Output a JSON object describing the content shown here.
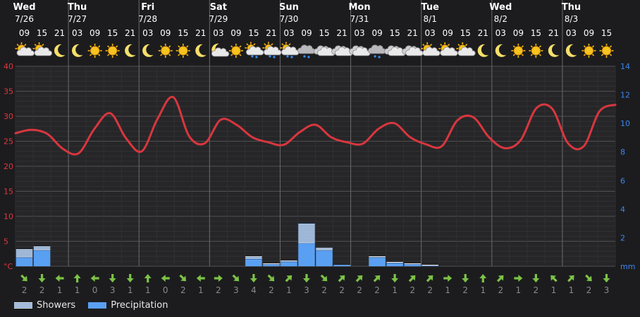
{
  "days": [
    {
      "name": "Wed",
      "date": "7/26"
    },
    {
      "name": "Thu",
      "date": "7/27"
    },
    {
      "name": "Fri",
      "date": "7/28"
    },
    {
      "name": "Sat",
      "date": "7/29"
    },
    {
      "name": "Sun",
      "date": "7/30"
    },
    {
      "name": "Mon",
      "date": "7/31"
    },
    {
      "name": "Tue",
      "date": "8/1"
    },
    {
      "name": "Wed",
      "date": "8/2"
    },
    {
      "name": "Thu",
      "date": "8/3"
    }
  ],
  "hours": [
    "09",
    "15",
    "21",
    "03",
    "09",
    "15",
    "21",
    "03",
    "09",
    "15",
    "21",
    "03",
    "09",
    "15",
    "21",
    "03",
    "09",
    "15",
    "21",
    "03",
    "09",
    "15",
    "21",
    "03",
    "09",
    "15",
    "21",
    "03",
    "09",
    "15",
    "21",
    "03",
    "09",
    "15"
  ],
  "icons": [
    "partly-sunny",
    "partly-sunny",
    "moon",
    "moon",
    "sun",
    "sun",
    "moon",
    "moon",
    "sun",
    "sun",
    "moon",
    "partly-cloudy-night",
    "sun",
    "sun-shower",
    "sun-shower",
    "sun-shower",
    "rain-cloud",
    "cloud",
    "cloud",
    "cloud",
    "rain-cloud",
    "cloud",
    "cloud",
    "partly-sunny",
    "partly-sunny",
    "partly-sunny",
    "moon",
    "moon",
    "sun",
    "sun",
    "moon",
    "moon",
    "sun",
    "sun"
  ],
  "wind": {
    "directions": [
      "SE",
      "S",
      "W",
      "N",
      "W",
      "S",
      "S",
      "N",
      "W",
      "SE",
      "W",
      "E",
      "SE",
      "S",
      "SE",
      "NE",
      "S",
      "SE",
      "NE",
      "NE",
      "NE",
      "S",
      "NE",
      "NE",
      "E",
      "S",
      "N",
      "NE",
      "E",
      "S",
      "NW",
      "NE",
      "SE",
      "S"
    ],
    "speeds": [
      "2",
      "2",
      "1",
      "1",
      "0",
      "3",
      "1",
      "1",
      "0",
      "2",
      "1",
      "2",
      "3",
      "4",
      "2",
      "1",
      "3",
      "2",
      "2",
      "2",
      "2",
      "1",
      "2",
      "2",
      "1",
      "2",
      "1",
      "2",
      "1",
      "2",
      "1",
      "1",
      "2",
      "3"
    ]
  },
  "chart_data": {
    "type": "line",
    "temperature": {
      "unit": "°C",
      "ylim": [
        0,
        40
      ],
      "ticks": [
        "°C",
        "5",
        "10",
        "15",
        "20",
        "25",
        "30",
        "35",
        "40"
      ],
      "values": [
        26.6,
        27.3,
        26.5,
        23.5,
        22.6,
        27.5,
        30.6,
        25.6,
        23.0,
        29.5,
        33.8,
        26.0,
        24.6,
        29.3,
        28.3,
        25.8,
        24.8,
        24.3,
        26.8,
        28.3,
        25.8,
        24.8,
        24.5,
        27.5,
        28.6,
        25.8,
        24.4,
        24.0,
        29.2,
        29.8,
        25.8,
        23.6,
        25.2,
        31.6,
        31.5,
        24.6,
        24.0,
        31.0,
        32.3
      ]
    },
    "precipitation": {
      "unit": "mm",
      "ylim": [
        0,
        14
      ],
      "ticks": [
        "mm",
        "2",
        "4",
        "6",
        "8",
        "10",
        "12",
        "14"
      ],
      "values": [
        0.6,
        1.1,
        0,
        0,
        0,
        0,
        0,
        0,
        0,
        0,
        0,
        0,
        0,
        0.5,
        0.1,
        0.3,
        1.6,
        1.1,
        0.1,
        0,
        0.6,
        0.2,
        0.1,
        0,
        0,
        0,
        0,
        0,
        0,
        0,
        0,
        0,
        0,
        0
      ],
      "showers": [
        0.6,
        0.3,
        0,
        0,
        0,
        0,
        0,
        0,
        0,
        0,
        0,
        0,
        0,
        0.2,
        0.1,
        0.1,
        1.4,
        0.2,
        0,
        0,
        0.1,
        0.1,
        0.1,
        0.1,
        0,
        0,
        0,
        0,
        0,
        0,
        0,
        0,
        0,
        0
      ]
    },
    "grid": true
  },
  "legend": {
    "showers": "Showers",
    "precipitation": "Precipitation"
  },
  "colors": {
    "temp_line": "#d9363e",
    "precip": "#5aa0f2",
    "temp_axis": "#e0373f",
    "precip_axis": "#3b87f0",
    "wind": "#7cc246",
    "grid": "#3d3d40",
    "day_line": "#6a6a6c"
  }
}
